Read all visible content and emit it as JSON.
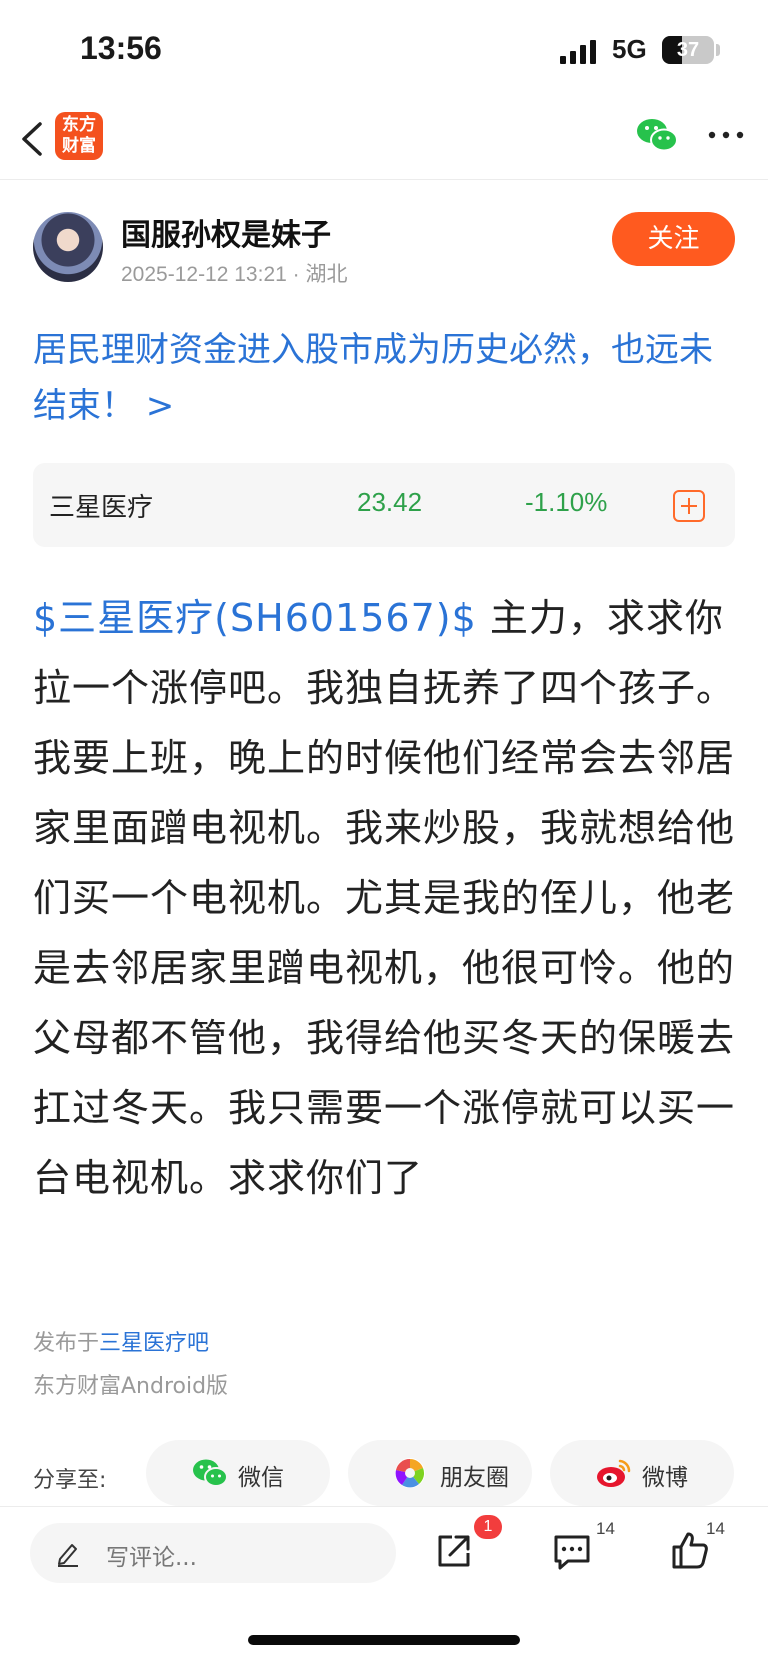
{
  "status_bar": {
    "time": "13:56",
    "network": "5G",
    "battery": "37"
  },
  "nav": {
    "logo_line1": "东方",
    "logo_line2": "财富"
  },
  "author": {
    "name": "国服孙权是妹子",
    "meta": "2025-12-12 13:21 · 湖北",
    "follow_label": "关注"
  },
  "headline": "居民理财资金进入股市成为历史必然，也远未结束！ >",
  "stock_card": {
    "name": "三星医疗",
    "price": "23.42",
    "change": "-1.10%",
    "change_color": "#2ea14a"
  },
  "post": {
    "stock_tag": "$三星医疗(SH601567)$",
    "text": " 主力，求求你拉一个涨停吧。我独自抚养了四个孩子。我要上班，晚上的时候他们经常会去邻居家里面蹭电视机。我来炒股，我就想给他们买一个电视机。尤其是我的侄儿，他老是去邻居家里蹭电视机，他很可怜。他的父母都不管他，我得给他买冬天的保暖去扛过冬天。我只需要一个涨停就可以买一台电视机。求求你们了"
  },
  "source": {
    "forum_prefix": "发布于",
    "forum_link": "三星医疗吧",
    "client": "东方财富Android版"
  },
  "share": {
    "label": "分享至:",
    "wechat": "微信",
    "moments": "朋友圈",
    "weibo": "微博"
  },
  "bottom_bar": {
    "comment_placeholder": "写评论...",
    "share_badge": "1",
    "comment_count": "14",
    "like_count": "14"
  },
  "colors": {
    "accent": "#ff5a1f",
    "link": "#2a73d6",
    "down": "#2ea14a"
  }
}
